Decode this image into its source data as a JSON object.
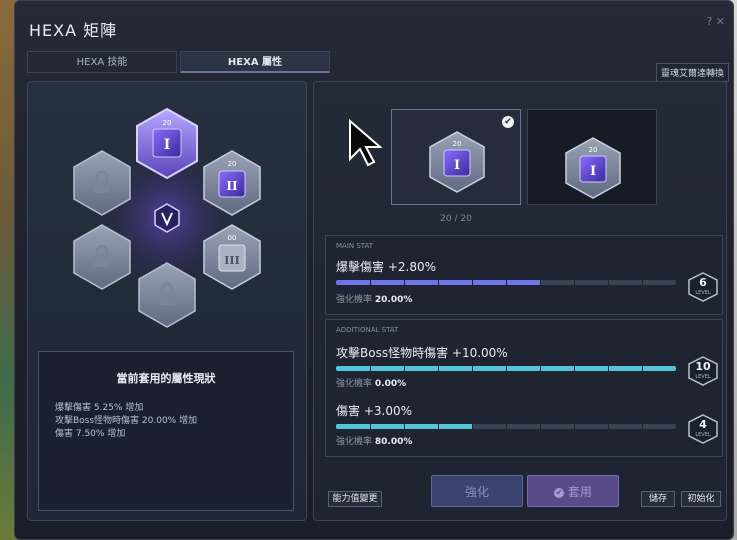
{
  "window": {
    "title": "HEXA 矩陣",
    "controls": "? ✕"
  },
  "tabs": [
    {
      "label": "HEXA 技能"
    },
    {
      "label": "HEXA 屬性"
    }
  ],
  "transfer_button": "靈魂艾爾達轉換",
  "hex_grid": {
    "center_icon": "v-emblem-icon",
    "nodes": [
      {
        "id": "top",
        "level": "20",
        "icon": "stat-core-1-icon",
        "state": "active"
      },
      {
        "id": "upper-right",
        "level": "20",
        "icon": "stat-core-2-icon",
        "state": "unlocked"
      },
      {
        "id": "lower-right",
        "level": "00",
        "icon": "stat-core-3-icon",
        "state": "unlocked"
      },
      {
        "id": "bottom",
        "state": "locked",
        "icon": "lock-icon"
      },
      {
        "id": "lower-left",
        "state": "locked",
        "icon": "lock-icon"
      },
      {
        "id": "upper-left",
        "state": "locked",
        "icon": "lock-icon"
      }
    ]
  },
  "status_box": {
    "title": "當前套用的屬性現狀",
    "lines": [
      "爆擊傷害 5.25% 增加",
      "攻擊Boss怪物時傷害 20.00% 增加",
      "傷害 7.50% 增加"
    ]
  },
  "slots": {
    "count_text": "20 / 20"
  },
  "main_stat": {
    "header": "MAIN STAT",
    "name": "爆擊傷害 +2.80%",
    "rate_label": "強化機率",
    "rate": "20.00%",
    "level": "6",
    "level_label": "LEVEL",
    "progress": 0.6
  },
  "additional_stat": {
    "header": "ADDITIONAL STAT",
    "items": [
      {
        "name": "攻擊Boss怪物時傷害 +10.00%",
        "rate_label": "強化機率",
        "rate": "0.00%",
        "level": "10",
        "level_label": "LEVEL",
        "progress": 1.0
      },
      {
        "name": "傷害 +3.00%",
        "rate_label": "強化機率",
        "rate": "80.00%",
        "level": "4",
        "level_label": "LEVEL",
        "progress": 0.4
      }
    ]
  },
  "buttons": {
    "change": "能力值變更",
    "enhance": "強化",
    "apply": "套用",
    "save": "儲存",
    "reset": "初始化"
  },
  "colors": {
    "main_bar": "#6e74e8",
    "add_bar": "#52c6d8",
    "accent_purple": "#7a5cd6"
  }
}
